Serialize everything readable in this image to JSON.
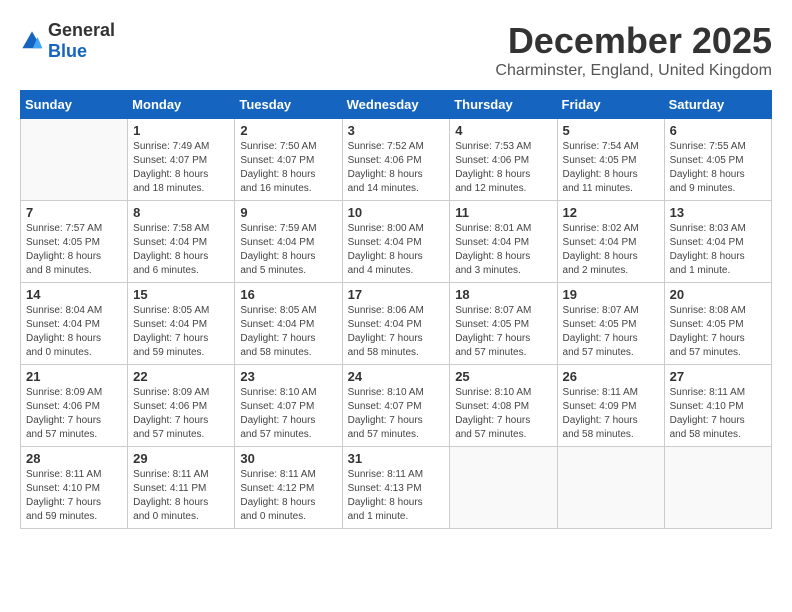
{
  "logo": {
    "general": "General",
    "blue": "Blue"
  },
  "header": {
    "month": "December 2025",
    "location": "Charminster, England, United Kingdom"
  },
  "weekdays": [
    "Sunday",
    "Monday",
    "Tuesday",
    "Wednesday",
    "Thursday",
    "Friday",
    "Saturday"
  ],
  "weeks": [
    [
      {
        "day": "",
        "info": ""
      },
      {
        "day": "1",
        "info": "Sunrise: 7:49 AM\nSunset: 4:07 PM\nDaylight: 8 hours\nand 18 minutes."
      },
      {
        "day": "2",
        "info": "Sunrise: 7:50 AM\nSunset: 4:07 PM\nDaylight: 8 hours\nand 16 minutes."
      },
      {
        "day": "3",
        "info": "Sunrise: 7:52 AM\nSunset: 4:06 PM\nDaylight: 8 hours\nand 14 minutes."
      },
      {
        "day": "4",
        "info": "Sunrise: 7:53 AM\nSunset: 4:06 PM\nDaylight: 8 hours\nand 12 minutes."
      },
      {
        "day": "5",
        "info": "Sunrise: 7:54 AM\nSunset: 4:05 PM\nDaylight: 8 hours\nand 11 minutes."
      },
      {
        "day": "6",
        "info": "Sunrise: 7:55 AM\nSunset: 4:05 PM\nDaylight: 8 hours\nand 9 minutes."
      }
    ],
    [
      {
        "day": "7",
        "info": "Sunrise: 7:57 AM\nSunset: 4:05 PM\nDaylight: 8 hours\nand 8 minutes."
      },
      {
        "day": "8",
        "info": "Sunrise: 7:58 AM\nSunset: 4:04 PM\nDaylight: 8 hours\nand 6 minutes."
      },
      {
        "day": "9",
        "info": "Sunrise: 7:59 AM\nSunset: 4:04 PM\nDaylight: 8 hours\nand 5 minutes."
      },
      {
        "day": "10",
        "info": "Sunrise: 8:00 AM\nSunset: 4:04 PM\nDaylight: 8 hours\nand 4 minutes."
      },
      {
        "day": "11",
        "info": "Sunrise: 8:01 AM\nSunset: 4:04 PM\nDaylight: 8 hours\nand 3 minutes."
      },
      {
        "day": "12",
        "info": "Sunrise: 8:02 AM\nSunset: 4:04 PM\nDaylight: 8 hours\nand 2 minutes."
      },
      {
        "day": "13",
        "info": "Sunrise: 8:03 AM\nSunset: 4:04 PM\nDaylight: 8 hours\nand 1 minute."
      }
    ],
    [
      {
        "day": "14",
        "info": "Sunrise: 8:04 AM\nSunset: 4:04 PM\nDaylight: 8 hours\nand 0 minutes."
      },
      {
        "day": "15",
        "info": "Sunrise: 8:05 AM\nSunset: 4:04 PM\nDaylight: 7 hours\nand 59 minutes."
      },
      {
        "day": "16",
        "info": "Sunrise: 8:05 AM\nSunset: 4:04 PM\nDaylight: 7 hours\nand 58 minutes."
      },
      {
        "day": "17",
        "info": "Sunrise: 8:06 AM\nSunset: 4:04 PM\nDaylight: 7 hours\nand 58 minutes."
      },
      {
        "day": "18",
        "info": "Sunrise: 8:07 AM\nSunset: 4:05 PM\nDaylight: 7 hours\nand 57 minutes."
      },
      {
        "day": "19",
        "info": "Sunrise: 8:07 AM\nSunset: 4:05 PM\nDaylight: 7 hours\nand 57 minutes."
      },
      {
        "day": "20",
        "info": "Sunrise: 8:08 AM\nSunset: 4:05 PM\nDaylight: 7 hours\nand 57 minutes."
      }
    ],
    [
      {
        "day": "21",
        "info": "Sunrise: 8:09 AM\nSunset: 4:06 PM\nDaylight: 7 hours\nand 57 minutes."
      },
      {
        "day": "22",
        "info": "Sunrise: 8:09 AM\nSunset: 4:06 PM\nDaylight: 7 hours\nand 57 minutes."
      },
      {
        "day": "23",
        "info": "Sunrise: 8:10 AM\nSunset: 4:07 PM\nDaylight: 7 hours\nand 57 minutes."
      },
      {
        "day": "24",
        "info": "Sunrise: 8:10 AM\nSunset: 4:07 PM\nDaylight: 7 hours\nand 57 minutes."
      },
      {
        "day": "25",
        "info": "Sunrise: 8:10 AM\nSunset: 4:08 PM\nDaylight: 7 hours\nand 57 minutes."
      },
      {
        "day": "26",
        "info": "Sunrise: 8:11 AM\nSunset: 4:09 PM\nDaylight: 7 hours\nand 58 minutes."
      },
      {
        "day": "27",
        "info": "Sunrise: 8:11 AM\nSunset: 4:10 PM\nDaylight: 7 hours\nand 58 minutes."
      }
    ],
    [
      {
        "day": "28",
        "info": "Sunrise: 8:11 AM\nSunset: 4:10 PM\nDaylight: 7 hours\nand 59 minutes."
      },
      {
        "day": "29",
        "info": "Sunrise: 8:11 AM\nSunset: 4:11 PM\nDaylight: 8 hours\nand 0 minutes."
      },
      {
        "day": "30",
        "info": "Sunrise: 8:11 AM\nSunset: 4:12 PM\nDaylight: 8 hours\nand 0 minutes."
      },
      {
        "day": "31",
        "info": "Sunrise: 8:11 AM\nSunset: 4:13 PM\nDaylight: 8 hours\nand 1 minute."
      },
      {
        "day": "",
        "info": ""
      },
      {
        "day": "",
        "info": ""
      },
      {
        "day": "",
        "info": ""
      }
    ]
  ]
}
